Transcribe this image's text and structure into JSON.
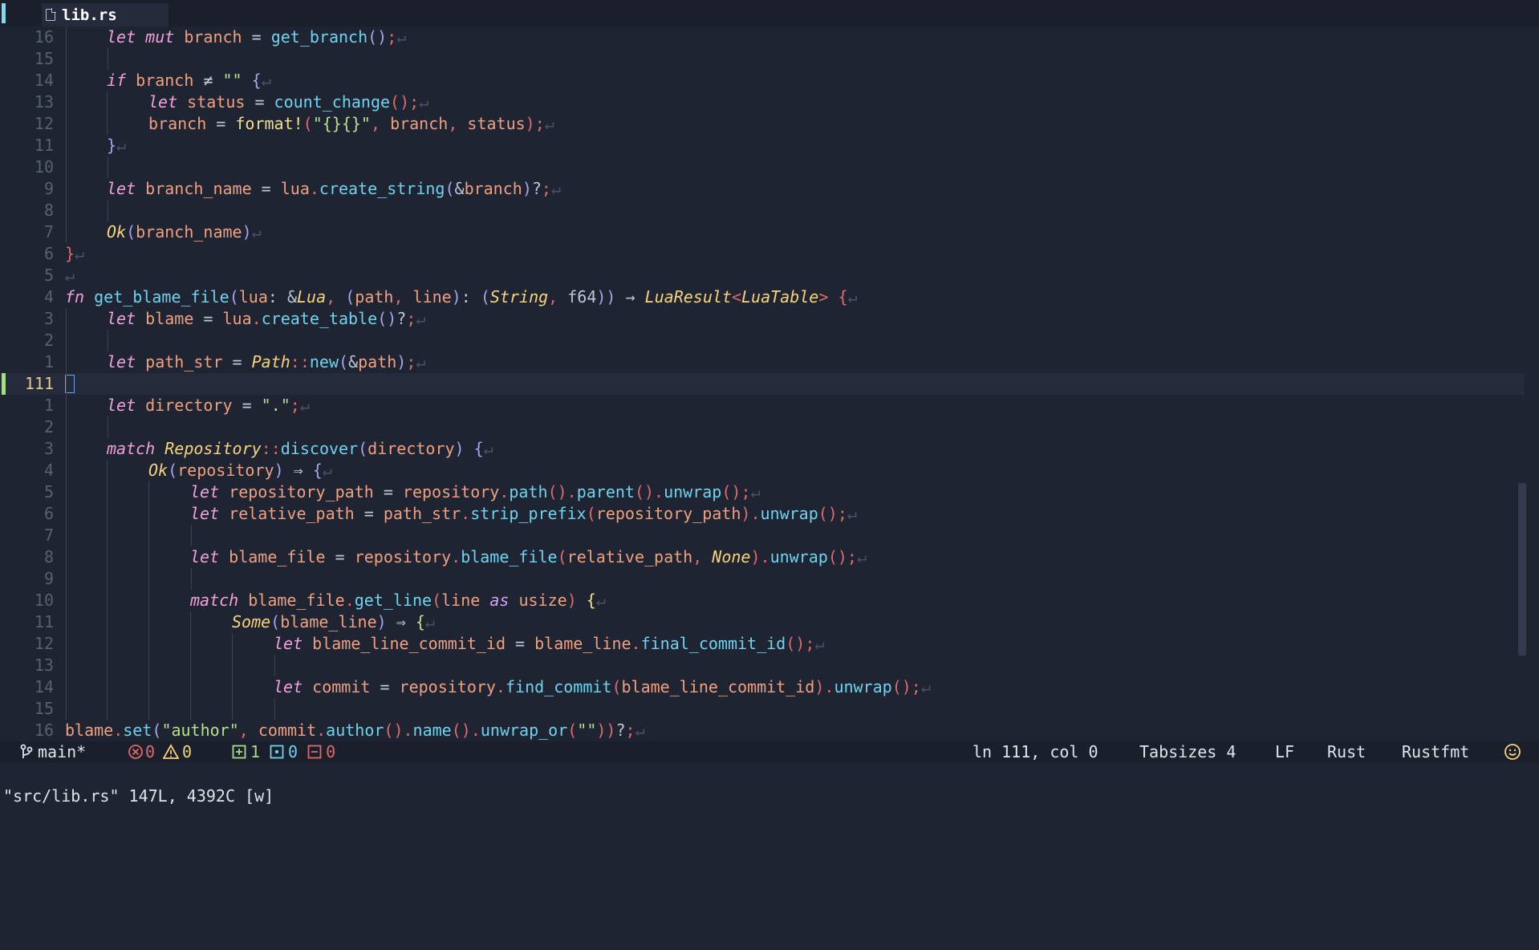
{
  "tab": {
    "filename": "lib.rs"
  },
  "editor": {
    "current_line_number": "111",
    "lines": [
      {
        "n": "16",
        "segs": [
          [
            "kw",
            "let"
          ],
          [
            "op",
            " "
          ],
          [
            "kw",
            "mut"
          ],
          [
            "op",
            " "
          ],
          [
            "var",
            "branch"
          ],
          [
            "op",
            " = "
          ],
          [
            "fn",
            "get_branch"
          ],
          [
            "p2",
            "()"
          ],
          [
            "p",
            ";"
          ],
          [
            "nl",
            "↵"
          ]
        ]
      },
      {
        "n": "15",
        "segs": []
      },
      {
        "n": "14",
        "segs": [
          [
            "kw",
            "if"
          ],
          [
            "op",
            " "
          ],
          [
            "var",
            "branch"
          ],
          [
            "op",
            " ≠ "
          ],
          [
            "str",
            "\"\""
          ],
          [
            "op",
            " "
          ],
          [
            "p2",
            "{"
          ],
          [
            "nl",
            "↵"
          ]
        ]
      },
      {
        "n": "13",
        "segs": [
          [
            "kw",
            "let"
          ],
          [
            "op",
            " "
          ],
          [
            "var",
            "status"
          ],
          [
            "op",
            " = "
          ],
          [
            "fn",
            "count_change"
          ],
          [
            "p",
            "()"
          ],
          [
            "p",
            ";"
          ],
          [
            "nl",
            "↵"
          ]
        ]
      },
      {
        "n": "12",
        "segs": [
          [
            "var",
            "branch"
          ],
          [
            "op",
            " = "
          ],
          [
            "mac",
            "format!"
          ],
          [
            "p",
            "("
          ],
          [
            "str",
            "\"{}{}\""
          ],
          [
            "p",
            ", "
          ],
          [
            "var",
            "branch"
          ],
          [
            "p",
            ", "
          ],
          [
            "var",
            "status"
          ],
          [
            "p",
            ");"
          ],
          [
            "nl",
            "↵"
          ]
        ]
      },
      {
        "n": "11",
        "segs": [
          [
            "p2",
            "}"
          ],
          [
            "nl",
            "↵"
          ]
        ]
      },
      {
        "n": "10",
        "segs": []
      },
      {
        "n": "9",
        "segs": [
          [
            "kw",
            "let"
          ],
          [
            "op",
            " "
          ],
          [
            "var",
            "branch_name"
          ],
          [
            "op",
            " = "
          ],
          [
            "var",
            "lua"
          ],
          [
            "p",
            "."
          ],
          [
            "fn",
            "create_string"
          ],
          [
            "p2",
            "("
          ],
          [
            "op",
            "&"
          ],
          [
            "var",
            "branch"
          ],
          [
            "p2",
            ")"
          ],
          [
            "op",
            "?"
          ],
          [
            "p",
            ";"
          ],
          [
            "nl",
            "↵"
          ]
        ]
      },
      {
        "n": "8",
        "segs": []
      },
      {
        "n": "7",
        "segs": [
          [
            "ty",
            "Ok"
          ],
          [
            "p2",
            "("
          ],
          [
            "var",
            "branch_name"
          ],
          [
            "p2",
            ")"
          ],
          [
            "nl",
            "↵"
          ]
        ]
      },
      {
        "n": "6",
        "segs": [
          [
            "p",
            "}"
          ],
          [
            "nl",
            "↵"
          ]
        ]
      },
      {
        "n": "5",
        "segs": [
          [
            "nl",
            "↵"
          ]
        ]
      },
      {
        "n": "4",
        "segs": [
          [
            "kw",
            "fn"
          ],
          [
            "op",
            " "
          ],
          [
            "fn",
            "get_blame_file"
          ],
          [
            "p2",
            "("
          ],
          [
            "var",
            "lua"
          ],
          [
            "op",
            ": &"
          ],
          [
            "ty",
            "Lua"
          ],
          [
            "p",
            ", "
          ],
          [
            "p2",
            "("
          ],
          [
            "var",
            "path"
          ],
          [
            "p",
            ", "
          ],
          [
            "var",
            "line"
          ],
          [
            "p2",
            ")"
          ],
          [
            "op",
            ": "
          ],
          [
            "p2",
            "("
          ],
          [
            "ty",
            "String"
          ],
          [
            "p",
            ", "
          ],
          [
            "op",
            "f64"
          ],
          [
            "p2",
            "))"
          ],
          [
            "op",
            " → "
          ],
          [
            "ty",
            "LuaResult"
          ],
          [
            "p",
            "<"
          ],
          [
            "ty",
            "LuaTable"
          ],
          [
            "p",
            ">"
          ],
          [
            "op",
            " "
          ],
          [
            "p",
            "{"
          ],
          [
            "nl",
            "↵"
          ]
        ]
      },
      {
        "n": "3",
        "segs": [
          [
            "kw",
            "let"
          ],
          [
            "op",
            " "
          ],
          [
            "var",
            "blame"
          ],
          [
            "op",
            " = "
          ],
          [
            "var",
            "lua"
          ],
          [
            "p",
            "."
          ],
          [
            "fn",
            "create_table"
          ],
          [
            "p2",
            "()"
          ],
          [
            "op",
            "?"
          ],
          [
            "p",
            ";"
          ],
          [
            "nl",
            "↵"
          ]
        ]
      },
      {
        "n": "2",
        "segs": []
      },
      {
        "n": "1",
        "segs": [
          [
            "kw",
            "let"
          ],
          [
            "op",
            " "
          ],
          [
            "var",
            "path_str"
          ],
          [
            "op",
            " = "
          ],
          [
            "ty",
            "Path"
          ],
          [
            "p",
            "::"
          ],
          [
            "fn",
            "new"
          ],
          [
            "p2",
            "("
          ],
          [
            "op",
            "&"
          ],
          [
            "var",
            "path"
          ],
          [
            "p2",
            ")"
          ],
          [
            "p",
            ";"
          ],
          [
            "nl",
            "↵"
          ]
        ]
      },
      {
        "n": "111",
        "segs": []
      },
      {
        "n": "1",
        "segs": [
          [
            "kw",
            "let"
          ],
          [
            "op",
            " "
          ],
          [
            "var",
            "directory"
          ],
          [
            "op",
            " = "
          ],
          [
            "str",
            "\".\""
          ],
          [
            "p",
            ";"
          ],
          [
            "nl",
            "↵"
          ]
        ]
      },
      {
        "n": "2",
        "segs": []
      },
      {
        "n": "3",
        "segs": [
          [
            "kw",
            "match"
          ],
          [
            "op",
            " "
          ],
          [
            "ty",
            "Repository"
          ],
          [
            "p",
            "::"
          ],
          [
            "fn",
            "discover"
          ],
          [
            "p2",
            "("
          ],
          [
            "var",
            "directory"
          ],
          [
            "p2",
            ")"
          ],
          [
            "op",
            " "
          ],
          [
            "p2",
            "{"
          ],
          [
            "nl",
            "↵"
          ]
        ]
      },
      {
        "n": "4",
        "segs": [
          [
            "ty",
            "Ok"
          ],
          [
            "p2",
            "("
          ],
          [
            "var",
            "repository"
          ],
          [
            "p2",
            ")"
          ],
          [
            "op",
            " ⇒ "
          ],
          [
            "p2",
            "{"
          ],
          [
            "nl",
            "↵"
          ]
        ]
      },
      {
        "n": "5",
        "segs": [
          [
            "kw",
            "let"
          ],
          [
            "op",
            " "
          ],
          [
            "var",
            "repository_path"
          ],
          [
            "op",
            " = "
          ],
          [
            "var",
            "repository"
          ],
          [
            "p",
            "."
          ],
          [
            "fn",
            "path"
          ],
          [
            "p",
            "()"
          ],
          [
            "p",
            "."
          ],
          [
            "fn",
            "parent"
          ],
          [
            "p",
            "()"
          ],
          [
            "p",
            "."
          ],
          [
            "fn",
            "unwrap"
          ],
          [
            "p",
            "()"
          ],
          [
            "p",
            ";"
          ],
          [
            "nl",
            "↵"
          ]
        ]
      },
      {
        "n": "6",
        "segs": [
          [
            "kw",
            "let"
          ],
          [
            "op",
            " "
          ],
          [
            "var",
            "relative_path"
          ],
          [
            "op",
            " = "
          ],
          [
            "var",
            "path_str"
          ],
          [
            "p",
            "."
          ],
          [
            "fn",
            "strip_prefix"
          ],
          [
            "p",
            "("
          ],
          [
            "var",
            "repository_path"
          ],
          [
            "p",
            ")"
          ],
          [
            "p",
            "."
          ],
          [
            "fn",
            "unwrap"
          ],
          [
            "p",
            "()"
          ],
          [
            "p",
            ";"
          ],
          [
            "nl",
            "↵"
          ]
        ]
      },
      {
        "n": "7",
        "segs": []
      },
      {
        "n": "8",
        "segs": [
          [
            "kw",
            "let"
          ],
          [
            "op",
            " "
          ],
          [
            "var",
            "blame_file"
          ],
          [
            "op",
            " = "
          ],
          [
            "var",
            "repository"
          ],
          [
            "p",
            "."
          ],
          [
            "fn",
            "blame_file"
          ],
          [
            "p",
            "("
          ],
          [
            "var",
            "relative_path"
          ],
          [
            "p",
            ", "
          ],
          [
            "ty",
            "None"
          ],
          [
            "p",
            ")"
          ],
          [
            "p",
            "."
          ],
          [
            "fn",
            "unwrap"
          ],
          [
            "p",
            "()"
          ],
          [
            "p",
            ";"
          ],
          [
            "nl",
            "↵"
          ]
        ]
      },
      {
        "n": "9",
        "segs": []
      },
      {
        "n": "10",
        "segs": [
          [
            "kw",
            "match"
          ],
          [
            "op",
            " "
          ],
          [
            "var",
            "blame_file"
          ],
          [
            "p",
            "."
          ],
          [
            "fn",
            "get_line"
          ],
          [
            "p",
            "("
          ],
          [
            "var",
            "line"
          ],
          [
            "op",
            " "
          ],
          [
            "kw2",
            "as"
          ],
          [
            "op",
            " "
          ],
          [
            "var",
            "usize"
          ],
          [
            "p",
            ")"
          ],
          [
            "op",
            " "
          ],
          [
            "mac",
            "{"
          ],
          [
            "nl",
            "↵"
          ]
        ]
      },
      {
        "n": "11",
        "segs": [
          [
            "ty",
            "Some"
          ],
          [
            "p2",
            "("
          ],
          [
            "var",
            "blame_line"
          ],
          [
            "p2",
            ")"
          ],
          [
            "op",
            " ⇒ "
          ],
          [
            "str",
            "{"
          ],
          [
            "nl",
            "↵"
          ]
        ]
      },
      {
        "n": "12",
        "segs": [
          [
            "kw",
            "let"
          ],
          [
            "op",
            " "
          ],
          [
            "var",
            "blame_line_commit_id"
          ],
          [
            "op",
            " = "
          ],
          [
            "var",
            "blame_line"
          ],
          [
            "p",
            "."
          ],
          [
            "fn",
            "final_commit_id"
          ],
          [
            "p",
            "()"
          ],
          [
            "p",
            ";"
          ],
          [
            "nl",
            "↵"
          ]
        ]
      },
      {
        "n": "13",
        "segs": []
      },
      {
        "n": "14",
        "segs": [
          [
            "kw",
            "let"
          ],
          [
            "op",
            " "
          ],
          [
            "var",
            "commit"
          ],
          [
            "op",
            " = "
          ],
          [
            "var",
            "repository"
          ],
          [
            "p",
            "."
          ],
          [
            "fn",
            "find_commit"
          ],
          [
            "p",
            "("
          ],
          [
            "var",
            "blame_line_commit_id"
          ],
          [
            "p",
            ")"
          ],
          [
            "p",
            "."
          ],
          [
            "fn",
            "unwrap"
          ],
          [
            "p",
            "()"
          ],
          [
            "p",
            ";"
          ],
          [
            "nl",
            "↵"
          ]
        ]
      },
      {
        "n": "15",
        "segs": []
      },
      {
        "n": "16",
        "segs": [
          [
            "var",
            "blame"
          ],
          [
            "p",
            "."
          ],
          [
            "fn",
            "set"
          ],
          [
            "p2",
            "("
          ],
          [
            "str",
            "\"author\""
          ],
          [
            "p",
            ", "
          ],
          [
            "var",
            "commit"
          ],
          [
            "p",
            "."
          ],
          [
            "fn",
            "author"
          ],
          [
            "p",
            "()"
          ],
          [
            "p",
            "."
          ],
          [
            "fn",
            "name"
          ],
          [
            "p",
            "()"
          ],
          [
            "p",
            "."
          ],
          [
            "fn",
            "unwrap_or"
          ],
          [
            "p",
            "("
          ],
          [
            "str",
            "\"\""
          ],
          [
            "p",
            "))"
          ],
          [
            "op",
            "?"
          ],
          [
            "p",
            ";"
          ],
          [
            "nl",
            "↵"
          ]
        ]
      }
    ]
  },
  "statusbar": {
    "branch": "main*",
    "errors": "0",
    "warnings": "0",
    "added": "1",
    "modified": "0",
    "removed": "0",
    "position": "ln 111, col 0",
    "tabsize": "Tabsizes 4",
    "eol": "LF",
    "language": "Rust",
    "formatter": "Rustfmt"
  },
  "cmdline": {
    "text": "\"src/lib.rs\" 147L, 4392C [w]"
  },
  "colors": {
    "background": "#1f2433",
    "keyword": "#f2a0d8",
    "type": "#f7d37a",
    "function": "#6fd3ed",
    "variable": "#f0a07e",
    "string": "#b6e089",
    "error": "#e06a6a",
    "added": "#a7dc8a"
  }
}
